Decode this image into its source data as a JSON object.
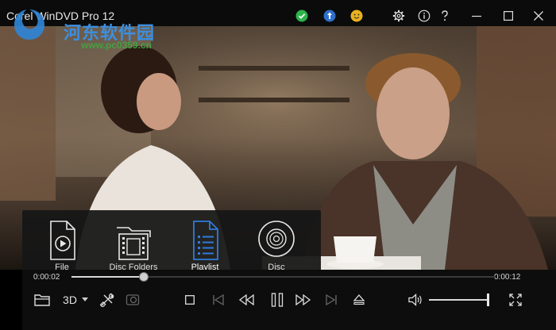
{
  "window": {
    "title": "Corel WinDVD Pro 12",
    "watermark": {
      "site": "河东软件园",
      "url": "www.pc0359.cn"
    },
    "top_icons": [
      "check-circle-icon",
      "upload-circle-icon",
      "smiley-icon",
      "settings-icon",
      "info-icon",
      "help-icon"
    ],
    "controls": [
      "minimize-icon",
      "maximize-icon",
      "close-icon"
    ]
  },
  "menu": {
    "items": [
      {
        "label": "File",
        "icon": "file-video-icon",
        "active": false
      },
      {
        "label": "Disc Folders",
        "icon": "disc-folder-icon",
        "active": false
      },
      {
        "label": "Playlist",
        "icon": "playlist-icon",
        "active": true
      },
      {
        "label": "Disc",
        "icon": "disc-icon",
        "active": false
      }
    ],
    "accent": "#2f7bd9"
  },
  "player": {
    "current_time": "0:00:02",
    "total_time": "0:00:12",
    "progress": 0.17,
    "mode_3d_label": "3D",
    "volume": 1.0
  }
}
